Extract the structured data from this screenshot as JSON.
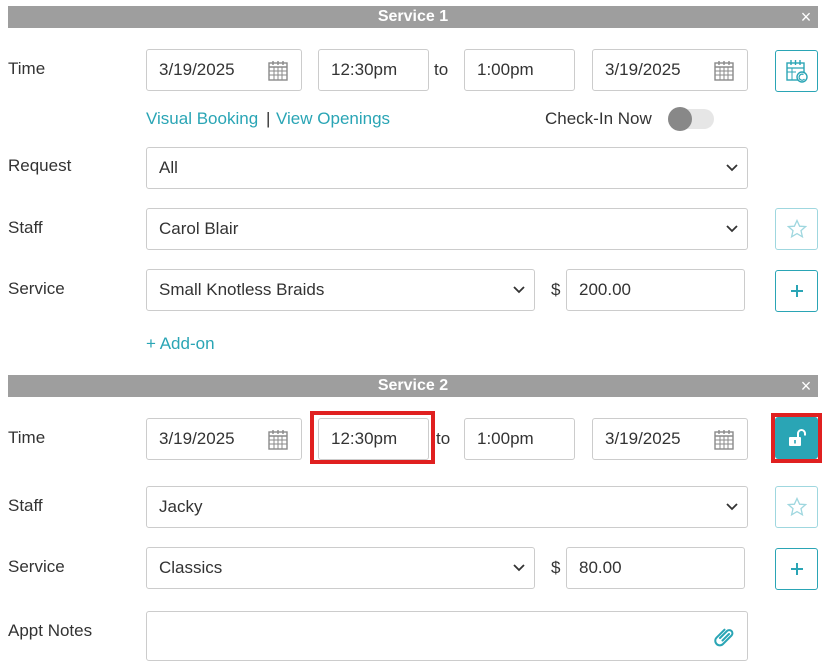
{
  "service1": {
    "title": "Service 1",
    "close": "×",
    "time_label": "Time",
    "start_date": "3/19/2025",
    "start_time": "12:30pm",
    "to": "to",
    "end_time": "1:00pm",
    "end_date": "3/19/2025",
    "visual_booking": "Visual Booking",
    "separator": "|",
    "view_openings": "View Openings",
    "checkin_label": "Check-In Now",
    "checkin_on": false,
    "request_label": "Request",
    "request_value": "All",
    "staff_label": "Staff",
    "staff_value": "Carol Blair",
    "service_label": "Service",
    "service_value": "Small Knotless Braids",
    "currency": "$",
    "price": "200.00",
    "add_on": "+ Add-on"
  },
  "service2": {
    "title": "Service 2",
    "close": "×",
    "time_label": "Time",
    "start_date": "3/19/2025",
    "start_time": "12:30pm",
    "to": "to",
    "end_time": "1:00pm",
    "end_date": "3/19/2025",
    "staff_label": "Staff",
    "staff_value": "Jacky",
    "service_label": "Service",
    "service_value": "Classics",
    "currency": "$",
    "price": "80.00"
  },
  "notes": {
    "label": "Appt Notes",
    "value": ""
  },
  "colors": {
    "accent": "#2aa5b5",
    "section_bar": "#9e9e9e",
    "highlight": "#e02020"
  },
  "icons": {
    "calendar": "calendar-icon",
    "calendar_refresh": "calendar-refresh-icon",
    "star": "star-icon",
    "plus": "plus-icon",
    "unlock": "unlock-icon",
    "paperclip": "paperclip-icon",
    "chevron": "chevron-down-icon",
    "close": "close-icon"
  }
}
